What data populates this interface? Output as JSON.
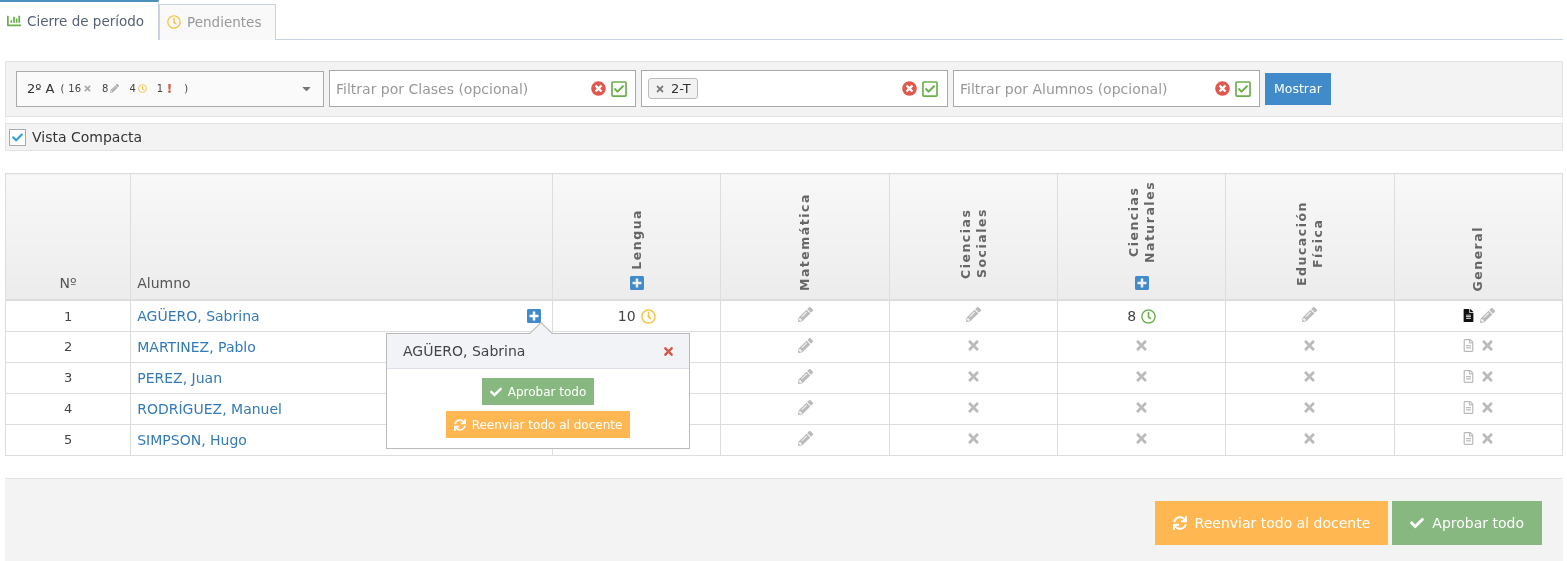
{
  "tabs": [
    {
      "label": "Cierre de período",
      "selected": true
    },
    {
      "label": "Pendientes",
      "selected": false
    }
  ],
  "filters": {
    "course": {
      "label": "2º A",
      "open_paren": "(",
      "close_paren": ")",
      "counts": [
        {
          "kind": "rejected",
          "value": "16"
        },
        {
          "kind": "pencil",
          "value": "8"
        },
        {
          "kind": "clock",
          "value": "4"
        },
        {
          "kind": "alert",
          "value": "1"
        }
      ]
    },
    "classes": {
      "placeholder": "Filtrar por Clases (opcional)"
    },
    "shift": {
      "tags": [
        "2-T"
      ]
    },
    "students": {
      "placeholder": "Filtrar por Alumnos (opcional)"
    },
    "show_button": "Mostrar"
  },
  "compact_view": {
    "label": "Vista Compacta",
    "checked": true
  },
  "table": {
    "columns": [
      {
        "label": "Nº",
        "kind": "plain",
        "add": false
      },
      {
        "label": "Alumno",
        "kind": "plain",
        "add": false
      },
      {
        "label": "Lengua",
        "kind": "subject",
        "add": true
      },
      {
        "label": "Matemática",
        "kind": "subject",
        "add": false
      },
      {
        "label": "Ciencias Sociales",
        "kind": "subject",
        "add": false
      },
      {
        "label": "Ciencias Naturales",
        "kind": "subject",
        "add": true
      },
      {
        "label": "Educación Física",
        "kind": "subject",
        "add": false
      },
      {
        "label": "General",
        "kind": "subject",
        "add": false
      }
    ],
    "rows": [
      {
        "cells": [
          {
            "kind": "number",
            "value": "1"
          },
          {
            "kind": "student",
            "value": "AGÜERO, Sabrina",
            "add": true
          },
          {
            "kind": "grade",
            "value": "10",
            "color": "#f5c342"
          },
          {
            "kind": "pencil"
          },
          {
            "kind": "pencil"
          },
          {
            "kind": "grade",
            "value": "8",
            "color": "#6ab04c"
          },
          {
            "kind": "pencil"
          },
          {
            "kind": "document_pencil",
            "document_active": true
          }
        ]
      },
      {
        "cells": [
          {
            "kind": "number",
            "value": "2"
          },
          {
            "kind": "student",
            "value": "MARTINEZ, Pablo",
            "add": false
          },
          {
            "kind": "covered"
          },
          {
            "kind": "pencil"
          },
          {
            "kind": "rejected"
          },
          {
            "kind": "rejected"
          },
          {
            "kind": "rejected"
          },
          {
            "kind": "document_rejected",
            "document_active": false
          }
        ]
      },
      {
        "cells": [
          {
            "kind": "number",
            "value": "3"
          },
          {
            "kind": "student",
            "value": "PEREZ, Juan",
            "add": false
          },
          {
            "kind": "covered"
          },
          {
            "kind": "pencil"
          },
          {
            "kind": "rejected"
          },
          {
            "kind": "rejected"
          },
          {
            "kind": "rejected"
          },
          {
            "kind": "document_rejected",
            "document_active": false
          }
        ]
      },
      {
        "cells": [
          {
            "kind": "number",
            "value": "4"
          },
          {
            "kind": "student",
            "value": "RODRÍGUEZ, Manuel",
            "add": false
          },
          {
            "kind": "covered"
          },
          {
            "kind": "pencil"
          },
          {
            "kind": "rejected"
          },
          {
            "kind": "rejected"
          },
          {
            "kind": "rejected"
          },
          {
            "kind": "document_rejected",
            "document_active": false
          }
        ]
      },
      {
        "cells": [
          {
            "kind": "number",
            "value": "5"
          },
          {
            "kind": "student",
            "value": "SIMPSON, Hugo",
            "add": false
          },
          {
            "kind": "covered"
          },
          {
            "kind": "pencil"
          },
          {
            "kind": "rejected"
          },
          {
            "kind": "rejected"
          },
          {
            "kind": "rejected"
          },
          {
            "kind": "document_rejected",
            "document_active": false
          }
        ]
      }
    ]
  },
  "popover": {
    "title": "AGÜERO, Sabrina",
    "approve": "Aprobar todo",
    "resend": "Reenviar todo al docente"
  },
  "footer": {
    "resend": "Reenviar todo al docente",
    "approve": "Aprobar todo"
  }
}
